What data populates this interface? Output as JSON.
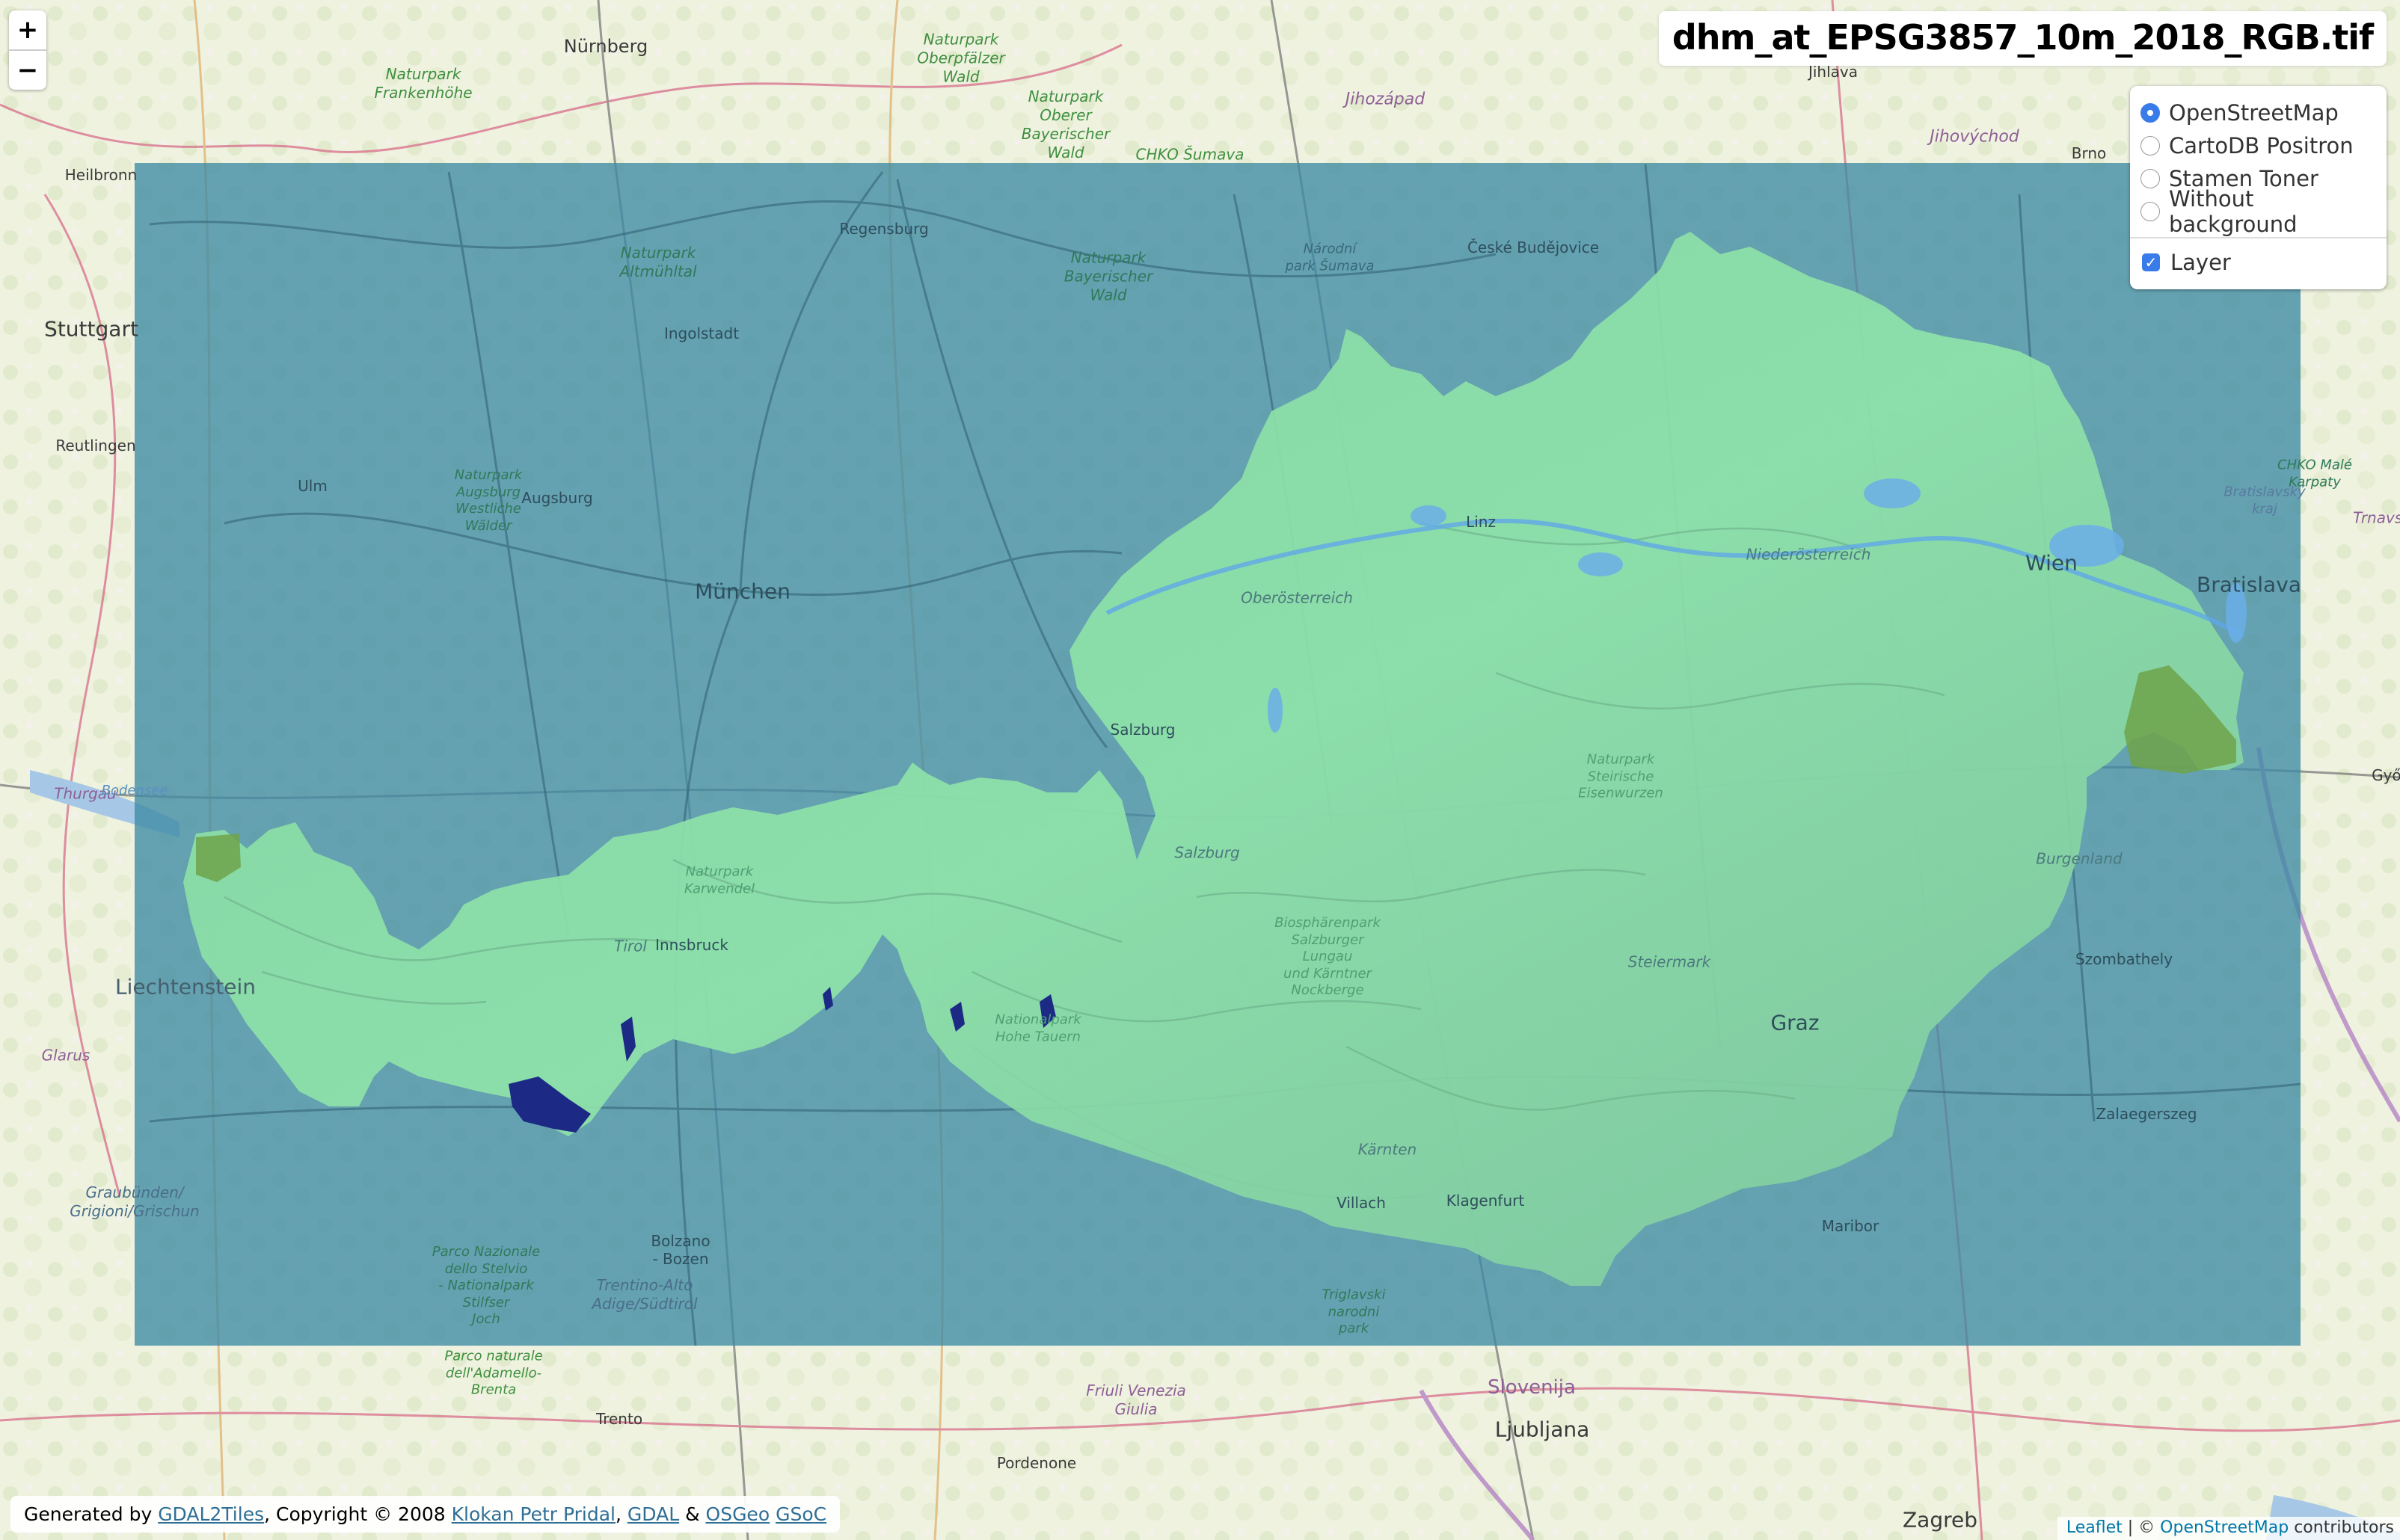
{
  "title": "dhm_at_EPSG3857_10m_2018_RGB.tif",
  "zoom_control": {
    "zoom_in": "+",
    "zoom_out": "−"
  },
  "layers_control": {
    "base_layers": [
      {
        "label": "OpenStreetMap",
        "selected": true
      },
      {
        "label": "CartoDB Positron",
        "selected": false
      },
      {
        "label": "Stamen Toner",
        "selected": false
      },
      {
        "label": "Without background",
        "selected": false
      }
    ],
    "overlays": [
      {
        "label": "Layer",
        "checked": true,
        "check_glyph": "✓"
      }
    ]
  },
  "overlay": {
    "colors": {
      "raster_bg": "#4b93ab",
      "terrain_low": "#7fbf9a",
      "terrain_high": "#8ee6a6",
      "glacier": "#1c2a86"
    }
  },
  "generated_by": {
    "prefix": "Generated by ",
    "gdal2tiles": "GDAL2Tiles",
    "copyright": ", Copyright © 2008 ",
    "klokan": "Klokan Petr Pridal",
    "comma": ", ",
    "gdal": "GDAL",
    "amp": " & ",
    "osgeo": "OSGeo",
    "space": " ",
    "gsoc": "GSoC"
  },
  "attribution": {
    "leaflet": "Leaflet",
    "separator": " | © ",
    "osm": "OpenStreetMap",
    "suffix": " contributors"
  },
  "map_labels": {
    "cities": [
      "Nürnberg",
      "Heilbronn",
      "Stuttgart",
      "Reutlingen",
      "Ulm",
      "Augsburg",
      "Ingolstadt",
      "Regensburg",
      "München",
      "Salzburg",
      "Linz",
      "Wien",
      "Bratislava",
      "Innsbruck",
      "Liechtenstein",
      "Graz",
      "Villach",
      "Klagenfurt",
      "Bolzano\n- Bozen",
      "Trento",
      "Pordenone",
      "Ljubljana",
      "Zagreb",
      "Maribor",
      "Szombathely",
      "Zalaegerszeg",
      "České Budějovice",
      "Jihlava",
      "Brno",
      "Győr"
    ],
    "parks": [
      "Naturpark\nFrankenhöhe",
      "Naturpark\nOberpfälzer\nWald",
      "Naturpark\nOberer\nBayerischer\nWald",
      "CHKO Šumava",
      "Naturpark\nAltmühltal",
      "Naturpark\nBayerischer\nWald",
      "Národní\npark Šumava",
      "Naturpark\nAugsburg\nWestliche\nWälder",
      "Naturpark\nKarwendel",
      "Nationalpark\nHohe Tauern",
      "Biosphärenpark\nSalzburger\nLungau\nund Kärntner\nNockberge",
      "Naturpark\nSteirische\nEisenwurzen",
      "Parco Nazionale\ndello Stelvio\n- Nationalpark\nStilfser\nJoch",
      "Parco naturale\ndell'Adamello-\nBrenta",
      "Triglavski\nnarodni\npark",
      "CHKO Malé\nKarpaty"
    ],
    "regions": [
      "Jihozápad",
      "Jihovýchod",
      "Oberösterreich",
      "Niederösterreich",
      "Salzburg",
      "Tirol",
      "Kärnten",
      "Steiermark",
      "Burgenland",
      "Thurgau",
      "Glarus",
      "Graubünden/\nGrigioni/Grischun",
      "Trentino-Alto\nAdige/Südtirol",
      "Friuli Venezia\nGiulia",
      "Slovenija",
      "Bratislavský\nkraj",
      "Bodensee",
      "Trnavsk"
    ]
  }
}
